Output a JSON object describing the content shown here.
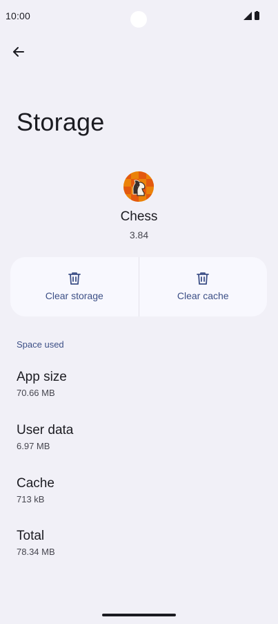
{
  "status_bar": {
    "time": "10:00"
  },
  "header": {
    "back_icon": "arrow-left-icon",
    "title": "Storage"
  },
  "app": {
    "icon": "chess-app-icon",
    "name": "Chess",
    "version": "3.84"
  },
  "actions": [
    {
      "icon": "trash-icon",
      "label": "Clear storage"
    },
    {
      "icon": "trash-icon",
      "label": "Clear cache"
    }
  ],
  "space_used": {
    "header": "Space used",
    "items": [
      {
        "title": "App size",
        "value": "70.66 MB"
      },
      {
        "title": "User data",
        "value": "6.97 MB"
      },
      {
        "title": "Cache",
        "value": "713 kB"
      },
      {
        "title": "Total",
        "value": "78.34 MB"
      }
    ]
  },
  "colors": {
    "background": "#f1f0f7",
    "accent": "#3c4f86",
    "card": "#f8f8fe"
  }
}
